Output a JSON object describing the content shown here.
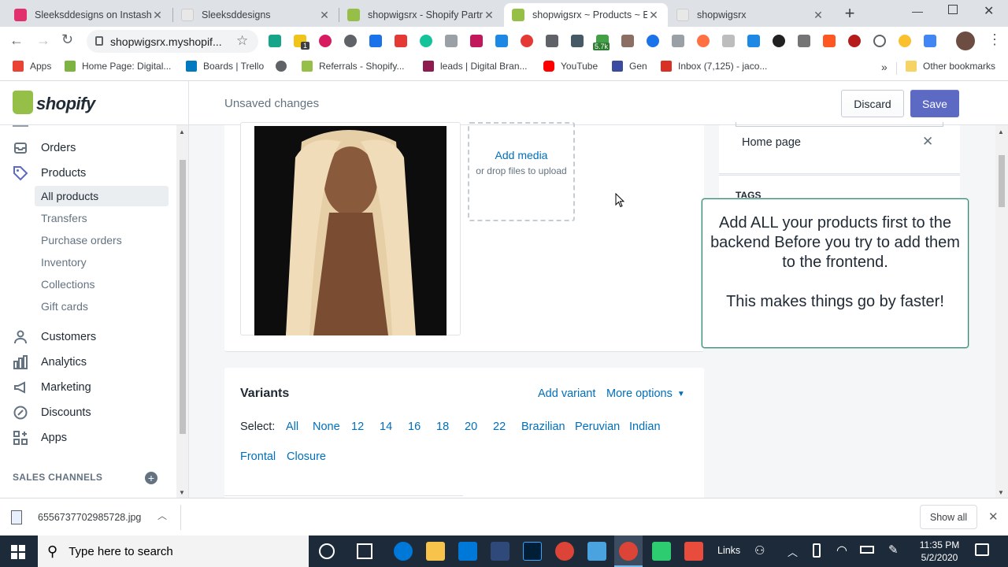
{
  "browser": {
    "tabs": [
      {
        "title": "Sleeksddesigns on Instasho",
        "fav_color": "#e1306c"
      },
      {
        "title": "Sleeksddesigns",
        "fav_color": "#e8e8e8"
      },
      {
        "title": "shopwigsrx - Shopify Partne",
        "fav_color": "#95bf47"
      },
      {
        "title": "shopwigsrx ~ Products ~ E",
        "fav_color": "#95bf47"
      },
      {
        "title": "shopwigsrx",
        "fav_color": "#e8e8e8"
      }
    ],
    "new_tab": "+",
    "url": "shopwigsrx.myshopif...",
    "ext_badge_1": "1",
    "ext_badge_2": "5.7k",
    "bookmarks": [
      {
        "label": "Apps",
        "color": "#ea4335"
      },
      {
        "label": "Home Page: Digital...",
        "color": "#7cb342"
      },
      {
        "label": "Boards | Trello",
        "color": "#0079bf"
      },
      {
        "label": "",
        "color": "#5f6368"
      },
      {
        "label": "Referrals - Shopify...",
        "color": "#95bf47"
      },
      {
        "label": "leads | Digital Bran...",
        "color": "#8e1b4e"
      },
      {
        "label": "YouTube",
        "color": "#ff0000"
      },
      {
        "label": "Gen",
        "color": "#3b4ba0"
      },
      {
        "label": "Inbox (7,125) - jaco...",
        "color": "#d93025"
      }
    ],
    "more": "»",
    "other_bookmarks": "Other bookmarks"
  },
  "shopify": {
    "logo": "shopify",
    "unsaved": "Unsaved changes",
    "discard": "Discard",
    "save": "Save",
    "nav": [
      {
        "label": "Orders",
        "icon": "orders-icon"
      },
      {
        "label": "Products",
        "icon": "tag-icon"
      }
    ],
    "product_sub": [
      "All products",
      "Transfers",
      "Purchase orders",
      "Inventory",
      "Collections",
      "Gift cards"
    ],
    "nav2": [
      {
        "label": "Customers",
        "icon": "person-icon"
      },
      {
        "label": "Analytics",
        "icon": "bar-chart-icon"
      },
      {
        "label": "Marketing",
        "icon": "megaphone-icon"
      },
      {
        "label": "Discounts",
        "icon": "discount-icon"
      },
      {
        "label": "Apps",
        "icon": "apps-icon"
      }
    ],
    "sales_channels": "SALES CHANNELS",
    "add_media": "Add media",
    "drop_files": "or drop files to upload",
    "collection_tag": "Home page",
    "tags_heading": "TAGS",
    "variants_title": "Variants",
    "add_variant": "Add variant",
    "more_options": "More options",
    "select_label": "Select:",
    "select_options": [
      "All",
      "None",
      "12",
      "14",
      "16",
      "18",
      "20",
      "22",
      "Brazilian",
      "Peruvian",
      "Indian"
    ],
    "select_options_2": [
      "Frontal",
      "Closure"
    ]
  },
  "callout": {
    "line1": "Add ALL your products first to the backend Before you try to add them to the frontend.",
    "line2": "This makes things go by faster!"
  },
  "download": {
    "file": "6556737702985728.jpg",
    "show_all": "Show all"
  },
  "taskbar": {
    "search_placeholder": "Type here to search",
    "links": "Links",
    "time": "11:35 PM",
    "date": "5/2/2020"
  },
  "colors": {
    "save": "#5c6ac4",
    "link": "#006fbb",
    "callout_border": "#2e8b6f",
    "taskbar": "#1d2a3a"
  }
}
